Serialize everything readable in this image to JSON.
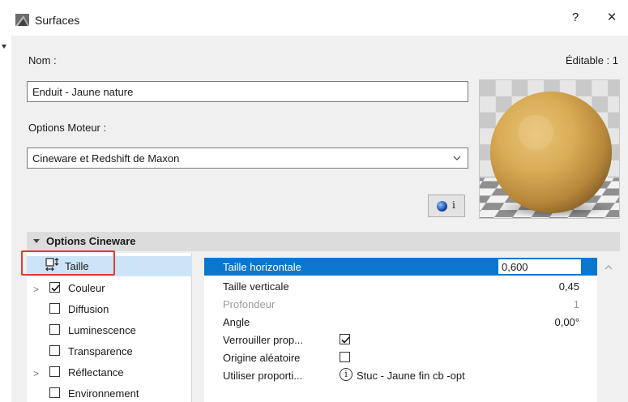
{
  "window": {
    "title": "Surfaces",
    "help_label": "?",
    "close_label": "×"
  },
  "header": {
    "name_label": "Nom :",
    "editable_label": "Éditable : 1",
    "name_value": "Enduit - Jaune nature",
    "engine_label": "Options Moteur :",
    "engine_value": "Cineware et Redshift de Maxon",
    "info_button_label": "i"
  },
  "section": {
    "title": "Options Cineware"
  },
  "channels": [
    {
      "label": "Taille",
      "selected": true,
      "checked": null
    },
    {
      "label": "Couleur",
      "checked": true,
      "expandable": true
    },
    {
      "label": "Diffusion",
      "checked": false
    },
    {
      "label": "Luminescence",
      "checked": false
    },
    {
      "label": "Transparence",
      "checked": false
    },
    {
      "label": "Réflectance",
      "checked": false,
      "expandable": true
    },
    {
      "label": "Environnement",
      "checked": false
    }
  ],
  "properties": [
    {
      "name": "Taille horizontale",
      "value": "0,600",
      "selected": true
    },
    {
      "name": "Taille verticale",
      "value": "0,45"
    },
    {
      "name": "Profondeur",
      "value": "1",
      "disabled": true
    },
    {
      "name": "Angle",
      "value": "0,00°"
    },
    {
      "name": "Verrouiller prop...",
      "checkbox": true
    },
    {
      "name": "Origine aléatoire",
      "checkbox": false
    },
    {
      "name": "Utiliser proporti...",
      "linked": "Stuc - Jaune fin cb -opt"
    }
  ]
}
